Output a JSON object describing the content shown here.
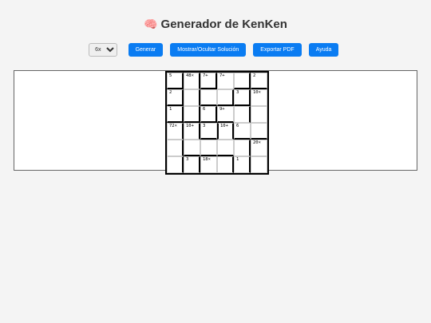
{
  "header": {
    "icon": "brain-icon",
    "title": "Generador de KenKen"
  },
  "toolbar": {
    "size_value": "6x6",
    "size_options": [
      "6x6"
    ],
    "generate_label": "Generar",
    "toggle_solution_label": "Mostrar/Ocultar Solución",
    "export_pdf_label": "Exportar PDF",
    "help_label": "Ayuda"
  },
  "puzzle": {
    "rows": [
      [
        "5",
        "48×",
        "7+",
        "7+",
        "",
        "2"
      ],
      [
        "2",
        "",
        "",
        "",
        "3",
        "10×"
      ],
      [
        "1",
        "",
        "6",
        "9+",
        "",
        ""
      ],
      [
        "72×",
        "10+",
        "3",
        "10+",
        "6",
        ""
      ],
      [
        "",
        "",
        "",
        "",
        "",
        "20×"
      ],
      [
        "",
        "3",
        "18×",
        "",
        "1",
        ""
      ]
    ]
  }
}
